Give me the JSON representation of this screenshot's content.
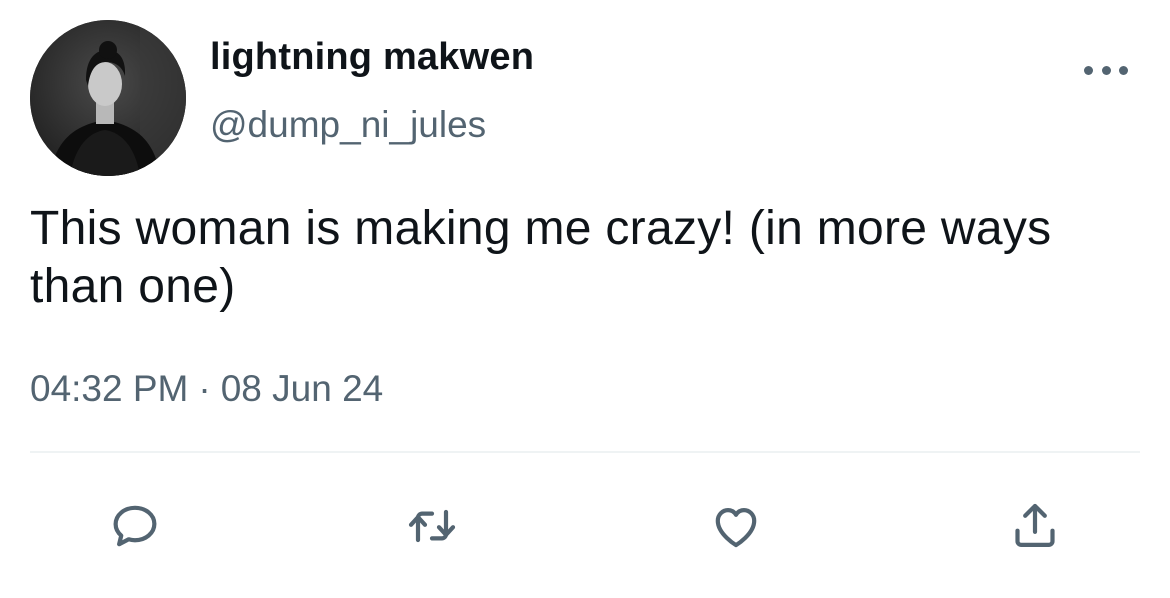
{
  "tweet": {
    "display_name": "lightning makwen",
    "handle": "@dump_ni_jules",
    "text": "This woman is making me crazy! (in more ways than one)",
    "time": "04:32 PM",
    "separator": "·",
    "date": "08 Jun 24"
  },
  "icons": {
    "more": "more-horizontal-icon",
    "reply": "reply-bubble-icon",
    "retweet": "retweet-icon",
    "like": "heart-icon",
    "share": "share-upload-icon"
  },
  "colors": {
    "text": "#0f1419",
    "secondary": "#536471",
    "divider": "#eff3f4"
  }
}
